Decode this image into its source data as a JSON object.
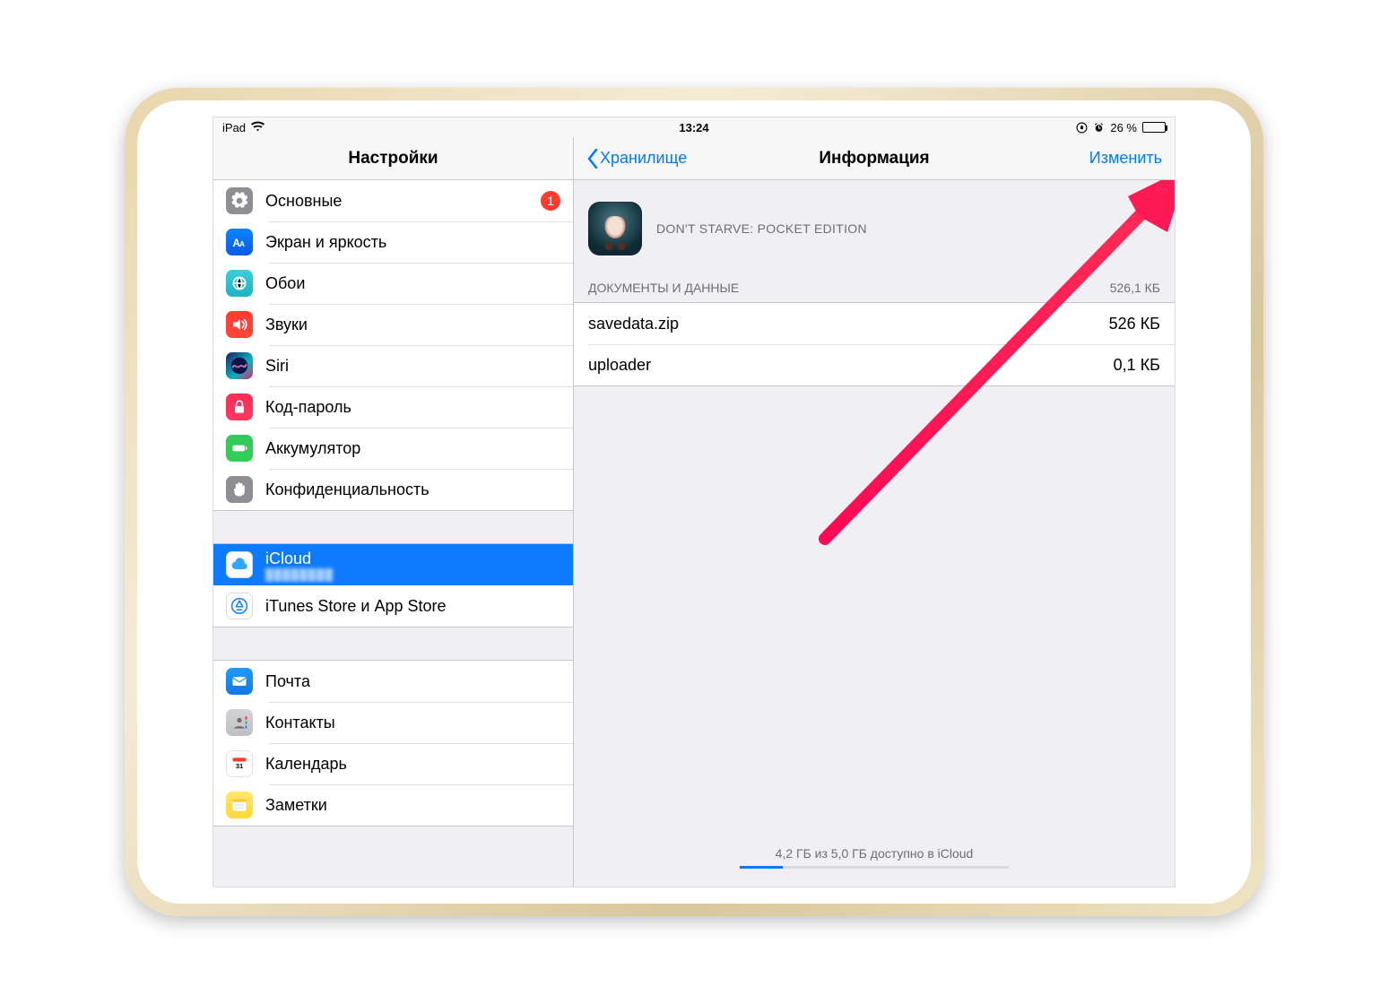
{
  "status": {
    "device": "iPad",
    "time": "13:24",
    "battery_pct": "26 %",
    "battery_fill_pct": 26
  },
  "sidebar": {
    "title": "Настройки",
    "groups": [
      {
        "items": [
          {
            "id": "general",
            "label": "Основные",
            "icon": "gear-icon",
            "badge": "1"
          },
          {
            "id": "display",
            "label": "Экран и яркость",
            "icon": "display-icon"
          },
          {
            "id": "wall",
            "label": "Обои",
            "icon": "wallpaper-icon"
          },
          {
            "id": "sound",
            "label": "Звуки",
            "icon": "sound-icon"
          },
          {
            "id": "siri",
            "label": "Siri",
            "icon": "siri-icon"
          },
          {
            "id": "pass",
            "label": "Код-пароль",
            "icon": "lock-icon"
          },
          {
            "id": "batt",
            "label": "Аккумулятор",
            "icon": "battery-icon"
          },
          {
            "id": "priv",
            "label": "Конфиденциальность",
            "icon": "hand-icon"
          }
        ]
      },
      {
        "items": [
          {
            "id": "icloud",
            "label": "iCloud",
            "sub": "",
            "icon": "cloud-icon",
            "selected": true
          },
          {
            "id": "store",
            "label": "iTunes Store и App Store",
            "icon": "appstore-icon"
          }
        ]
      },
      {
        "items": [
          {
            "id": "mail",
            "label": "Почта",
            "icon": "mail-icon"
          },
          {
            "id": "contacts",
            "label": "Контакты",
            "icon": "contacts-icon"
          },
          {
            "id": "cal",
            "label": "Календарь",
            "icon": "calendar-icon"
          },
          {
            "id": "notes",
            "label": "Заметки",
            "icon": "notes-icon"
          }
        ]
      }
    ]
  },
  "detail": {
    "back_label": "Хранилище",
    "title": "Информация",
    "edit_label": "Изменить",
    "app_name": "DON'T STARVE: POCKET EDITION",
    "section": {
      "title": "ДОКУМЕНТЫ И ДАННЫЕ",
      "total": "526,1 КБ"
    },
    "files": [
      {
        "name": "savedata.zip",
        "size": "526 КБ"
      },
      {
        "name": "uploader",
        "size": "0,1 КБ"
      }
    ],
    "footer": "4,2 ГБ из 5,0 ГБ доступно в iCloud",
    "used_pct": 16
  }
}
